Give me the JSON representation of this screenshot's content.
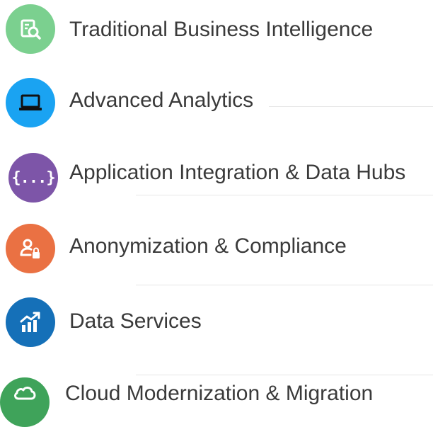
{
  "items": [
    {
      "label": "Traditional Business Intelligence",
      "icon": "report-search-icon",
      "color": "#7bd08f"
    },
    {
      "label": "Advanced Analytics",
      "icon": "laptop-icon",
      "color": "#1aa3f2"
    },
    {
      "label": "Application Integration & Data Hubs",
      "icon": "code-braces-icon",
      "color": "#7d55a8"
    },
    {
      "label": "Anonymization & Compliance",
      "icon": "user-lock-icon",
      "color": "#ea7143"
    },
    {
      "label": "Data Services",
      "icon": "chart-trending-up-icon",
      "color": "#1570b8"
    },
    {
      "label": "Cloud Modernization & Migration",
      "icon": "cloud-icon",
      "color": "#3fa35a"
    }
  ],
  "braces_glyph": "{...}"
}
